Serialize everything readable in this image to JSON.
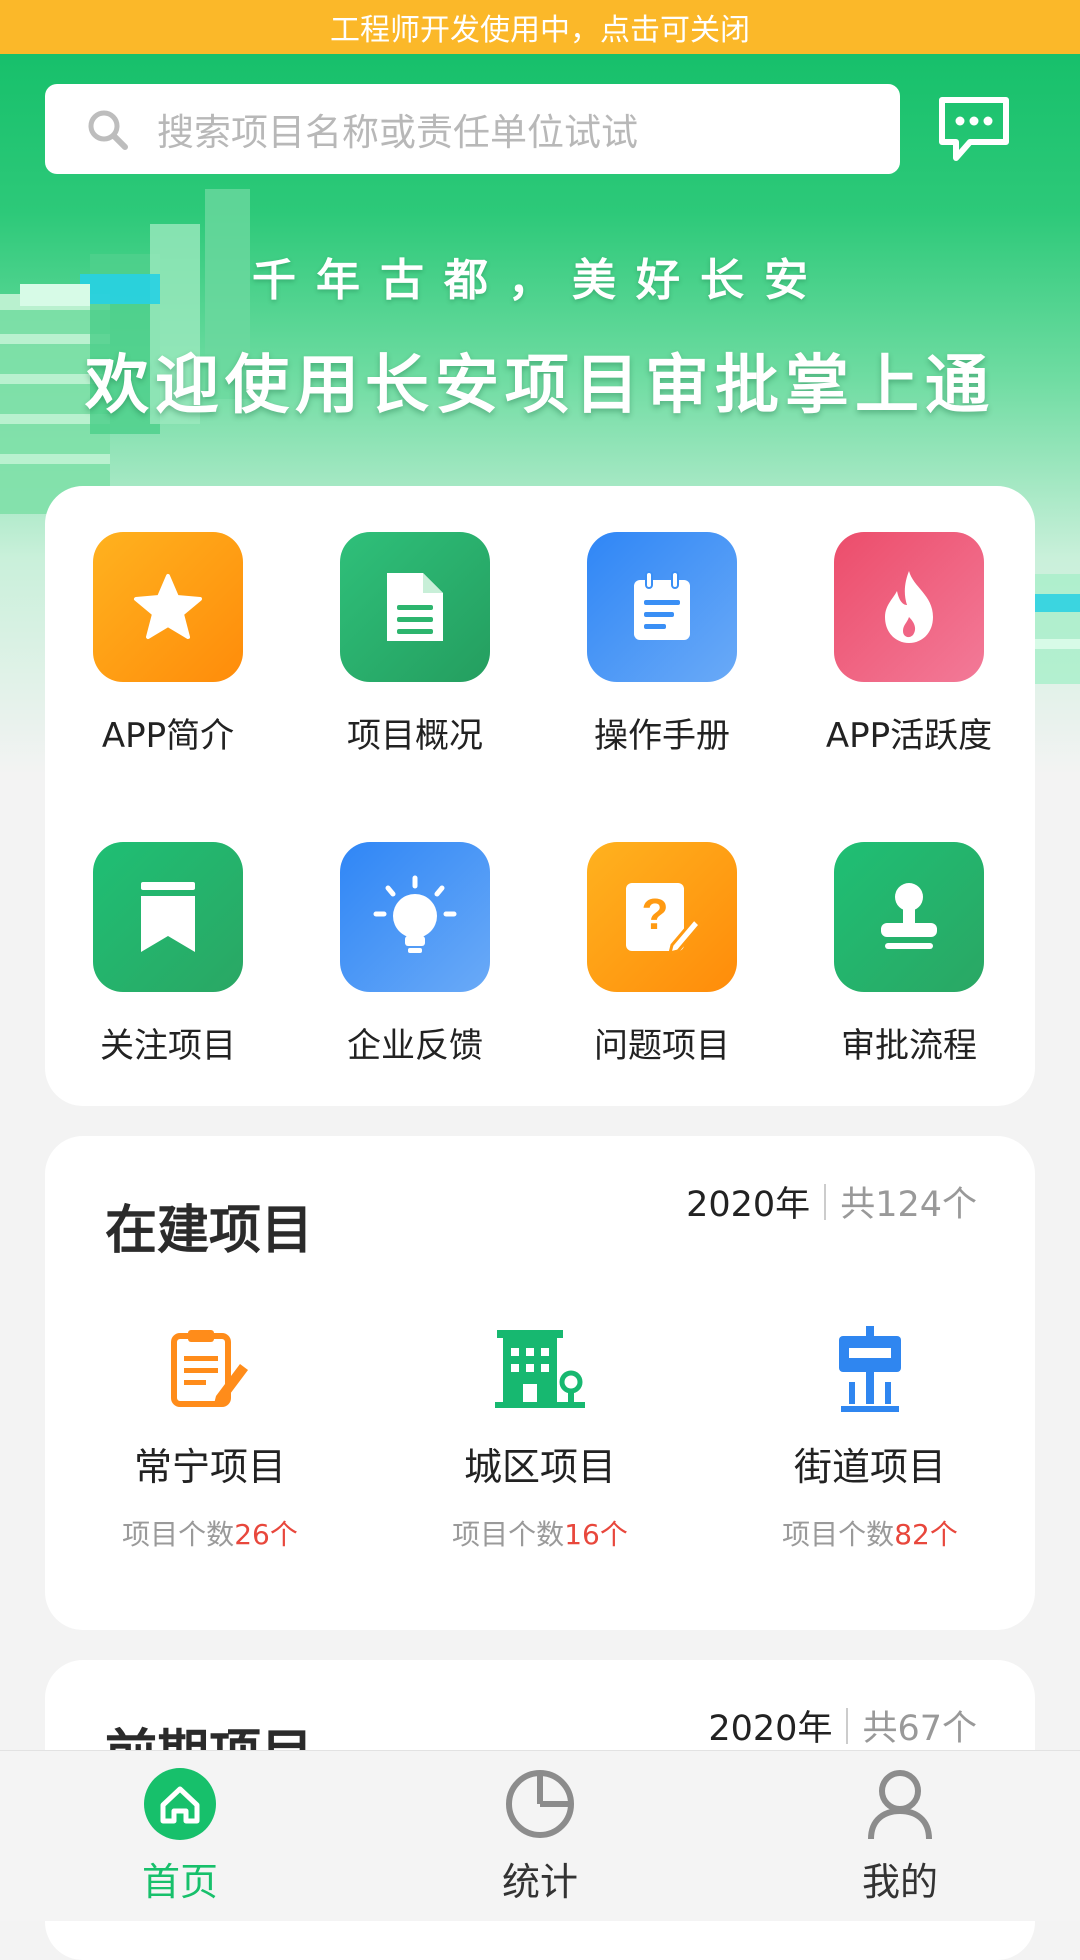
{
  "dev_banner": "工程师开发使用中，点击可关闭",
  "search": {
    "placeholder": "搜索项目名称或责任单位试试"
  },
  "hero": {
    "slogan_line1": "千年古都，美好长安",
    "slogan_line2": "欢迎使用长安项目审批掌上通"
  },
  "menu": [
    {
      "label": "APP简介",
      "icon": "star-icon",
      "color": "#ff9a12"
    },
    {
      "label": "项目概况",
      "icon": "document-icon",
      "color": "#2db56e"
    },
    {
      "label": "操作手册",
      "icon": "notepad-icon",
      "color": "#3a8ff5"
    },
    {
      "label": "APP活跃度",
      "icon": "flame-icon",
      "color": "#ef5b7a"
    },
    {
      "label": "关注项目",
      "icon": "bookmark-icon",
      "color": "#2db56e"
    },
    {
      "label": "企业反馈",
      "icon": "lightbulb-icon",
      "color": "#3a8ff5"
    },
    {
      "label": "问题项目",
      "icon": "question-edit-icon",
      "color": "#ff9a12"
    },
    {
      "label": "审批流程",
      "icon": "stamp-icon",
      "color": "#2db56e"
    }
  ],
  "in_progress": {
    "title": "在建项目",
    "year": "2020年",
    "total": "共124个",
    "items": [
      {
        "name": "常宁项目",
        "count_label": "项目个数",
        "count": "26个",
        "icon": "clipboard-edit-icon",
        "color": "#ff8c1a"
      },
      {
        "name": "城区项目",
        "count_label": "项目个数",
        "count": "16个",
        "icon": "building-icon",
        "color": "#17b870"
      },
      {
        "name": "街道项目",
        "count_label": "项目个数",
        "count": "82个",
        "icon": "signpost-icon",
        "color": "#2f86f0"
      }
    ]
  },
  "early_stage": {
    "title": "前期项目",
    "year": "2020年",
    "total": "共67个"
  },
  "tabs": [
    {
      "label": "首页",
      "icon": "home-icon",
      "active": true
    },
    {
      "label": "统计",
      "icon": "pie-chart-icon",
      "active": false
    },
    {
      "label": "我的",
      "icon": "user-icon",
      "active": false
    }
  ],
  "colors": {
    "primary": "#17c06b",
    "dev_banner": "#fbb829",
    "count_red": "#e8473c"
  }
}
